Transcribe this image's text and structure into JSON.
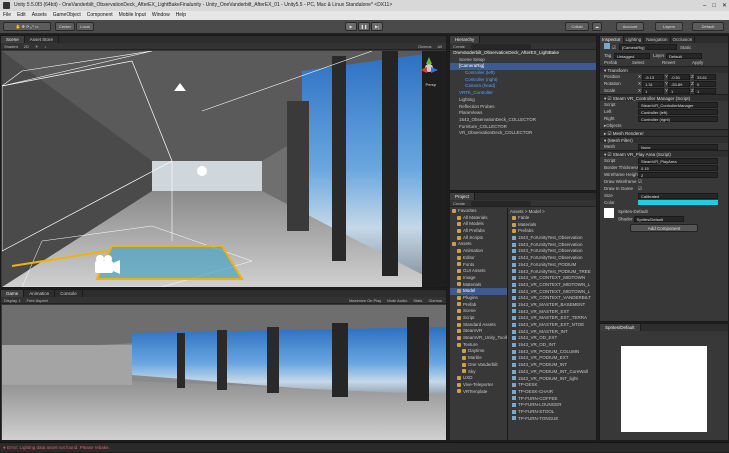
{
  "window": {
    "title": "Unity 5.5.0f3 (64bit) - OneVanderbilt_ObservationDeck_AfterEX_LightBakeFinalunity - Unity_OneVanderbilt_AfterEX_01 - Unity5.5 - PC, Mac & Linux Standalone* <DX11>"
  },
  "menu": [
    "File",
    "Edit",
    "Assets",
    "GameObject",
    "Component",
    "Mobile Input",
    "Window",
    "Help"
  ],
  "toolbar": {
    "center": "Center",
    "local": "Local",
    "collab": "Collab",
    "account": "Account",
    "layers": "Layers",
    "layout": "Default"
  },
  "scene": {
    "tabs": [
      "Scene",
      "Asset Store"
    ],
    "shaded": "Shaded",
    "gizmos": "Gizmos",
    "all": "All",
    "persp": "Persp"
  },
  "game": {
    "tabs": [
      "Game",
      "Animation",
      "Console"
    ],
    "display": "Display 1",
    "aspect": "Free Aspect",
    "maximize": "Maximize On Play",
    "mute": "Mute Audio",
    "stats": "Stats",
    "gizmos": "Gizmos"
  },
  "hierarchy": {
    "tab": "Hierarchy",
    "create": "Create",
    "scene": "OneVanderbilt_ObservationDeck_AfterEX_LightBake",
    "items": [
      {
        "label": "Scene Setup",
        "indent": 1,
        "style": "normal"
      },
      {
        "label": "[CameraRig]",
        "indent": 1,
        "style": "selected"
      },
      {
        "label": "Controller (left)",
        "indent": 2,
        "style": "blue"
      },
      {
        "label": "Controller (right)",
        "indent": 2,
        "style": "blue"
      },
      {
        "label": "Camera (head)",
        "indent": 2,
        "style": "blue"
      },
      {
        "label": "VRTK_Controller",
        "indent": 1,
        "style": "blue"
      },
      {
        "label": "Lighting",
        "indent": 1,
        "style": "normal"
      },
      {
        "label": "Reflection Probes",
        "indent": 1,
        "style": "normal"
      },
      {
        "label": "PlaneViews",
        "indent": 1,
        "style": "normal"
      },
      {
        "label": "1543_ObservationDeck_COLLECTOR",
        "indent": 1,
        "style": "normal"
      },
      {
        "label": "Furniture_COLLECTOR",
        "indent": 1,
        "style": "normal"
      },
      {
        "label": "VR_ObservationDeck_COLLECTOR",
        "indent": 1,
        "style": "normal"
      }
    ]
  },
  "project": {
    "tab": "Project",
    "create": "Create",
    "breadcrumb": "Assets > Model >",
    "tree": [
      {
        "label": "Favorites",
        "indent": 0
      },
      {
        "label": "All Materials",
        "indent": 1
      },
      {
        "label": "All Models",
        "indent": 1
      },
      {
        "label": "All Prefabs",
        "indent": 1
      },
      {
        "label": "All Scripts",
        "indent": 1
      },
      {
        "label": "Assets",
        "indent": 0
      },
      {
        "label": "Animation",
        "indent": 1
      },
      {
        "label": "Editor",
        "indent": 1
      },
      {
        "label": "Fonts",
        "indent": 1
      },
      {
        "label": "GUI Assets",
        "indent": 1
      },
      {
        "label": "Image",
        "indent": 1
      },
      {
        "label": "Materials",
        "indent": 1
      },
      {
        "label": "Model",
        "indent": 1,
        "selected": true
      },
      {
        "label": "Plugins",
        "indent": 1
      },
      {
        "label": "Prefab",
        "indent": 1
      },
      {
        "label": "Scene",
        "indent": 1
      },
      {
        "label": "Script",
        "indent": 1
      },
      {
        "label": "Standard Assets",
        "indent": 1
      },
      {
        "label": "SteamVR",
        "indent": 1
      },
      {
        "label": "SteamVR_Unity_Toolkit",
        "indent": 1
      },
      {
        "label": "Texture",
        "indent": 1
      },
      {
        "label": "Daytime",
        "indent": 2
      },
      {
        "label": "Marble",
        "indent": 2
      },
      {
        "label": "One Vanderbilt",
        "indent": 2
      },
      {
        "label": "Sky",
        "indent": 2
      },
      {
        "label": "UXD",
        "indent": 1
      },
      {
        "label": "Vive-Teleporter",
        "indent": 1
      },
      {
        "label": "VRTemplate",
        "indent": 1
      }
    ],
    "files": [
      "Fable",
      "Materials",
      "Prefabs",
      "1543_ForUnityTest_Observation",
      "1543_ForUnityTest_Observation",
      "1543_ForUnityTest_Observation",
      "1543_ForUnityTest_Observation",
      "1543_ForUnityTest_PODIUM",
      "1543_ForUnityTest_PODIUM_TREE",
      "1543_VR_CONTEXT_MIDTOWN",
      "1543_VR_CONTEXT_MIDTOWN_L",
      "1543_VR_CONTEXT_MIDTOWN_L",
      "1543_VR_CONTEXT_VANDERBILT",
      "1543_VR_MASTER_BASEMENT",
      "1543_VR_MASTER_EXT",
      "1543_VR_MASTER_EXT_TERRA",
      "1543_VR_MASTER_EXT_NTOE",
      "1543_VR_MASTER_INT",
      "1543_VR_OD_EXT",
      "1543_VR_OD_INT",
      "1543_VR_PODIUM_COLUMN",
      "1543_VR_PODIUM_EXT",
      "1543_VR_PODIUM_INT",
      "1543_VR_PODIUM_INT_CoreWall",
      "1543_VR_PODIUM_INT_light",
      "TP-DESK",
      "TP-DESK-CHAIR",
      "TP-FURN-COFFEE",
      "TP-FURN-LOUNGER",
      "TP-FURN-STOOL",
      "TP-FURN-TONGUE"
    ]
  },
  "inspector": {
    "tabs": [
      "Inspector",
      "Lighting",
      "Navigation",
      "Occlusion"
    ],
    "object_name": "[CameraRig]",
    "static": "Static",
    "tag": "Untagged",
    "layer": "Default",
    "prefab_label": "Prefab",
    "prefab_select": "Select",
    "prefab_revert": "Revert",
    "prefab_apply": "Apply",
    "transform": {
      "title": "Transform",
      "position": {
        "x": "-5.13",
        "y": "-0.51",
        "z": "33.61"
      },
      "rotation": {
        "x": "1.31",
        "y": "-53.89",
        "z": "0"
      },
      "scale": {
        "x": "1",
        "y": "1",
        "z": "1"
      }
    },
    "controller_manager": {
      "title": "Steam VR_Controller Manager (Script)",
      "script": "SteamVR_ControllerManager",
      "left": "Controller (left)",
      "right": "Controller (right)",
      "objects": "Objects"
    },
    "mesh_renderer": "Mesh Renderer",
    "mesh_filter": "(Mesh Filter)",
    "mesh": "None",
    "play_area": {
      "title": "Steam VR_Play Area (Script)",
      "script": "SteamVR_PlayArea",
      "border_thickness": "0.15",
      "wireframe_height": "2",
      "draw_wireframe": "Draw Wireframe",
      "draw_in_game": "Draw In Game",
      "size": "Calibrated"
    },
    "material": "Sprites-Default",
    "shader_label": "Shader",
    "shader": "Sprites/Default",
    "add_component": "Add Component",
    "preview_title": "Sprites/Default"
  },
  "status": "Error: Lighting data asset not found. Please rebake."
}
